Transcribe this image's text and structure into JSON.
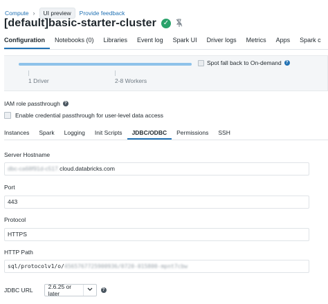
{
  "breadcrumb": {
    "compute": "Compute",
    "separator": "›",
    "preview": "UI preview",
    "feedback": "Provide feedback"
  },
  "header": {
    "title": "[default]basic-starter-cluster",
    "status_icon": "check-circle-icon",
    "status_color": "#2aa26b"
  },
  "main_tabs": [
    {
      "label": "Configuration",
      "active": true
    },
    {
      "label": "Notebooks (0)",
      "active": false
    },
    {
      "label": "Libraries",
      "active": false
    },
    {
      "label": "Event log",
      "active": false
    },
    {
      "label": "Spark UI",
      "active": false
    },
    {
      "label": "Driver logs",
      "active": false
    },
    {
      "label": "Metrics",
      "active": false
    },
    {
      "label": "Apps",
      "active": false
    },
    {
      "label": "Spark c",
      "active": false
    }
  ],
  "workers": {
    "spot_label": "Spot fall back to On-demand",
    "driver_label": "1 Driver",
    "workers_label": "2-8 Workers"
  },
  "iam": {
    "title": "IAM role passthrough",
    "checkbox_label": "Enable credential passthrough for user-level data access"
  },
  "sub_tabs": [
    {
      "label": "Instances",
      "active": false
    },
    {
      "label": "Spark",
      "active": false
    },
    {
      "label": "Logging",
      "active": false
    },
    {
      "label": "Init Scripts",
      "active": false
    },
    {
      "label": "JDBC/ODBC",
      "active": true
    },
    {
      "label": "Permissions",
      "active": false
    },
    {
      "label": "SSH",
      "active": false
    }
  ],
  "fields": {
    "server_hostname": {
      "label": "Server Hostname",
      "value_redacted": "dbc-ca68f91d-c517.",
      "value_visible": "cloud.databricks.com"
    },
    "port": {
      "label": "Port",
      "value": "443"
    },
    "protocol": {
      "label": "Protocol",
      "value": "HTTPS"
    },
    "http_path": {
      "label": "HTTP Path",
      "value_visible": "sql/protocolv1/o/",
      "value_redacted": "4565767725900936/0720-015800-mpnt7cbw"
    }
  },
  "jdbc": {
    "label": "JDBC URL",
    "selected": "2.6.25 or later"
  },
  "accent_color": "#2272b4"
}
